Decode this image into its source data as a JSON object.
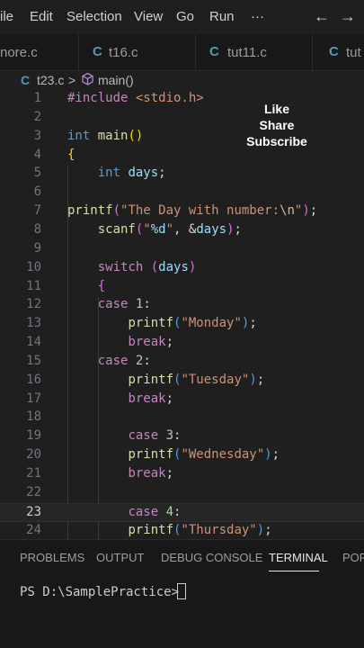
{
  "menu": {
    "file": "ile",
    "edit": "Edit",
    "selection": "Selection",
    "view": "View",
    "go": "Go",
    "run": "Run",
    "more": "···",
    "back": "←",
    "forward": "→"
  },
  "tabs": [
    {
      "label": "nore.c"
    },
    {
      "icon": "C",
      "label": "t16.c"
    },
    {
      "icon": "C",
      "label": "tut11.c"
    },
    {
      "icon": "C",
      "label": "tut"
    }
  ],
  "breadcrumb": {
    "icon": "C",
    "file": "t23.c",
    "sep": ">",
    "symbol": "main()"
  },
  "overlay": {
    "like": "Like",
    "share": "Share",
    "subscribe": "Subscribe"
  },
  "editor": {
    "active_line": 23,
    "line_numbers": [
      "1",
      "2",
      "3",
      "4",
      "5",
      "6",
      "7",
      "8",
      "9",
      "10",
      "11",
      "12",
      "13",
      "14",
      "15",
      "16",
      "17",
      "18",
      "19",
      "20",
      "21",
      "22",
      "23",
      "24"
    ],
    "lines": [
      [
        {
          "t": "#include ",
          "c": "kw-pp"
        },
        {
          "t": "<stdio.h>",
          "c": "str"
        }
      ],
      [],
      [
        {
          "t": "int ",
          "c": "kw"
        },
        {
          "t": "main",
          "c": "fn"
        },
        {
          "t": "()",
          "c": "brace1"
        }
      ],
      [
        {
          "t": "{",
          "c": "brace1"
        }
      ],
      [
        {
          "t": "    "
        },
        {
          "t": "int ",
          "c": "kw"
        },
        {
          "t": "days",
          "c": "var"
        },
        {
          "t": ";",
          "c": "plain"
        }
      ],
      [],
      [
        {
          "t": "printf",
          "c": "fn"
        },
        {
          "t": "(",
          "c": "brace2"
        },
        {
          "t": "\"The Day with number:",
          "c": "str"
        },
        {
          "t": "\\n",
          "c": "esc"
        },
        {
          "t": "\"",
          "c": "str"
        },
        {
          "t": ")",
          "c": "brace2"
        },
        {
          "t": ";",
          "c": "plain"
        }
      ],
      [
        {
          "t": "    "
        },
        {
          "t": "scanf",
          "c": "fn"
        },
        {
          "t": "(",
          "c": "brace2"
        },
        {
          "t": "\"",
          "c": "str"
        },
        {
          "t": "%d",
          "c": "var"
        },
        {
          "t": "\"",
          "c": "str"
        },
        {
          "t": ", &",
          "c": "plain"
        },
        {
          "t": "days",
          "c": "var"
        },
        {
          "t": ")",
          "c": "brace2"
        },
        {
          "t": ";",
          "c": "plain"
        }
      ],
      [],
      [
        {
          "t": "    "
        },
        {
          "t": "switch ",
          "c": "kw-ctrl"
        },
        {
          "t": "(",
          "c": "brace2"
        },
        {
          "t": "days",
          "c": "var"
        },
        {
          "t": ")",
          "c": "brace2"
        }
      ],
      [
        {
          "t": "    "
        },
        {
          "t": "{",
          "c": "brace2"
        }
      ],
      [
        {
          "t": "    "
        },
        {
          "t": "case ",
          "c": "kw-ctrl"
        },
        {
          "t": "1",
          "c": "num"
        },
        {
          "t": ":",
          "c": "plain"
        }
      ],
      [
        {
          "t": "        "
        },
        {
          "t": "printf",
          "c": "fn"
        },
        {
          "t": "(",
          "c": "kw"
        },
        {
          "t": "\"Monday\"",
          "c": "str"
        },
        {
          "t": ")",
          "c": "kw"
        },
        {
          "t": ";",
          "c": "plain"
        }
      ],
      [
        {
          "t": "        "
        },
        {
          "t": "break",
          "c": "kw-ctrl"
        },
        {
          "t": ";",
          "c": "plain"
        }
      ],
      [
        {
          "t": "    "
        },
        {
          "t": "case ",
          "c": "kw-ctrl"
        },
        {
          "t": "2",
          "c": "num"
        },
        {
          "t": ":",
          "c": "plain"
        }
      ],
      [
        {
          "t": "        "
        },
        {
          "t": "printf",
          "c": "fn"
        },
        {
          "t": "(",
          "c": "kw"
        },
        {
          "t": "\"Tuesday\"",
          "c": "str"
        },
        {
          "t": ")",
          "c": "kw"
        },
        {
          "t": ";",
          "c": "plain"
        }
      ],
      [
        {
          "t": "        "
        },
        {
          "t": "break",
          "c": "kw-ctrl"
        },
        {
          "t": ";",
          "c": "plain"
        }
      ],
      [],
      [
        {
          "t": "        "
        },
        {
          "t": "case ",
          "c": "kw-ctrl"
        },
        {
          "t": "3",
          "c": "num"
        },
        {
          "t": ":",
          "c": "plain"
        }
      ],
      [
        {
          "t": "        "
        },
        {
          "t": "printf",
          "c": "fn"
        },
        {
          "t": "(",
          "c": "kw"
        },
        {
          "t": "\"Wednesday\"",
          "c": "str"
        },
        {
          "t": ")",
          "c": "kw"
        },
        {
          "t": ";",
          "c": "plain"
        }
      ],
      [
        {
          "t": "        "
        },
        {
          "t": "break",
          "c": "kw-ctrl"
        },
        {
          "t": ";",
          "c": "plain"
        }
      ],
      [],
      [
        {
          "t": "        "
        },
        {
          "t": "case ",
          "c": "kw-ctrl"
        },
        {
          "t": "4",
          "c": "num"
        },
        {
          "t": ":",
          "c": "plain"
        }
      ],
      [
        {
          "t": "        "
        },
        {
          "t": "printf",
          "c": "fn"
        },
        {
          "t": "(",
          "c": "kw"
        },
        {
          "t": "\"Thursday\"",
          "c": "str"
        },
        {
          "t": ")",
          "c": "kw"
        },
        {
          "t": ";",
          "c": "plain"
        }
      ]
    ]
  },
  "panel": {
    "problems": "PROBLEMS",
    "output": "OUTPUT",
    "debug_console": "DEBUG CONSOLE",
    "terminal": "TERMINAL",
    "ports": "POR",
    "prompt": "PS D:\\SamplePractice> "
  }
}
